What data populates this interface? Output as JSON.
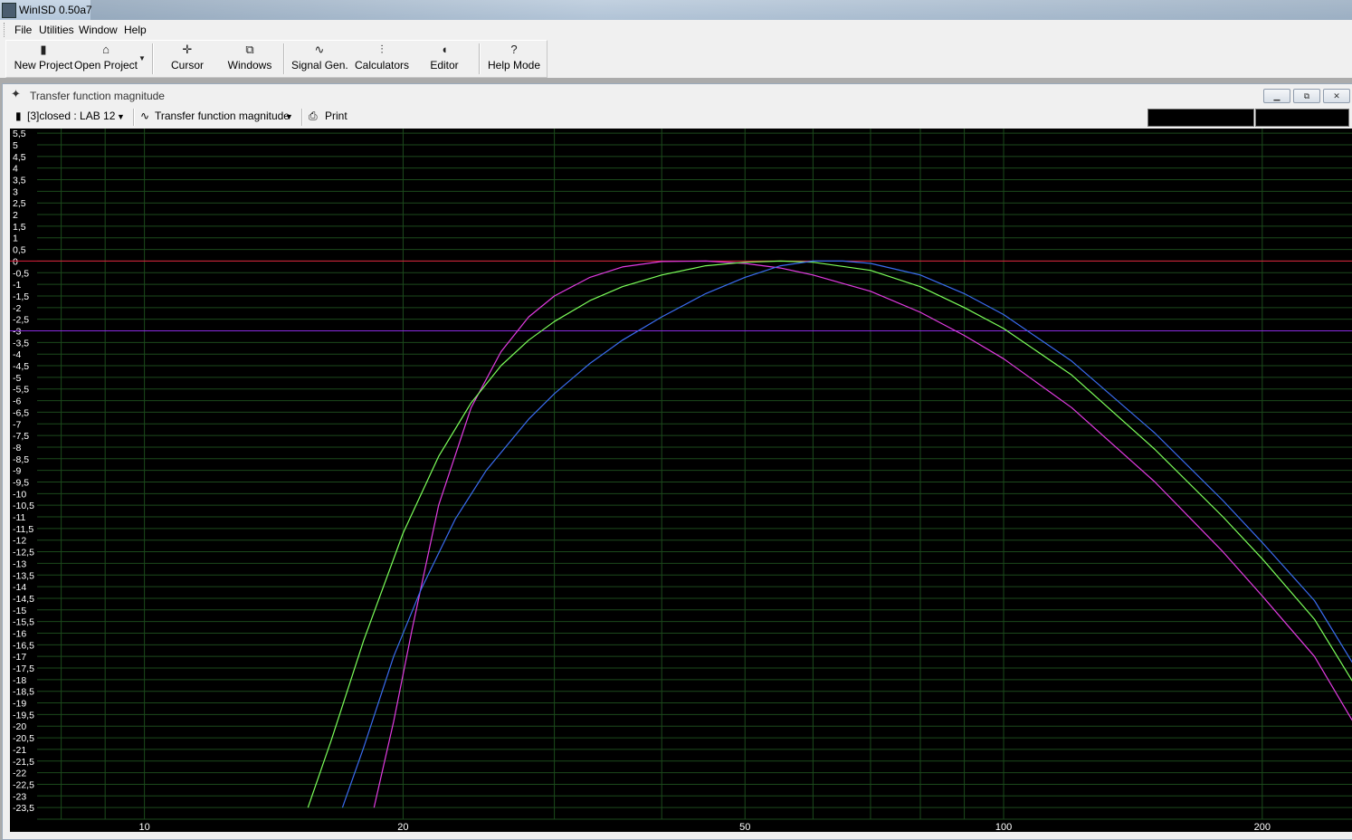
{
  "window": {
    "title": "WinISD 0.50a7"
  },
  "menu": [
    {
      "label": "File"
    },
    {
      "label": "Utilities"
    },
    {
      "label": "Window"
    },
    {
      "label": "Help"
    }
  ],
  "toolbar": {
    "new_project": "New Project",
    "open_project": "Open Project",
    "cursor": "Cursor",
    "windows": "Windows",
    "signal_gen": "Signal Gen.",
    "calculators": "Calculators",
    "editor": "Editor",
    "help_mode": "Help Mode"
  },
  "child_window": {
    "title": "Transfer function magnitude",
    "project_select": "[3]closed : LAB 12",
    "graph_select": "Transfer function magnitude",
    "print": "Print"
  },
  "colors": {
    "background": "#000000",
    "grid": "#1c4a1c",
    "zero_line": "#e0203c",
    "minus3_line": "#8a2be2",
    "series_magenta": "#e23be2",
    "series_green": "#7cff5a",
    "series_blue": "#3a6cf0"
  },
  "chart_data": {
    "type": "line",
    "x_scale": "log",
    "xlim": [
      7.5,
      255
    ],
    "ylim": [
      -24,
      5.7
    ],
    "x_tick_labels": [
      "10",
      "20",
      "50",
      "100",
      "200"
    ],
    "y_tick_labels": [
      "5,5",
      "5",
      "4,5",
      "4",
      "3,5",
      "3",
      "2,5",
      "2",
      "1,5",
      "1",
      "0,5",
      "0",
      "-0,5",
      "-1",
      "-1,5",
      "-2",
      "-2,5",
      "-3",
      "-3,5",
      "-4",
      "-4,5",
      "-5",
      "-5,5",
      "-6",
      "-6,5",
      "-7",
      "-7,5",
      "-8",
      "-8,5",
      "-9",
      "-9,5",
      "-10",
      "-10,5",
      "-11",
      "-11,5",
      "-12",
      "-12,5",
      "-13",
      "-13,5",
      "-14",
      "-14,5",
      "-15",
      "-15,5",
      "-16",
      "-16,5",
      "-17",
      "-17,5",
      "-18",
      "-18,5",
      "-19",
      "-19,5",
      "-20",
      "-20,5",
      "-21",
      "-21,5",
      "-22",
      "-22,5",
      "-23",
      "-23,5"
    ],
    "reference_lines": [
      {
        "y": 0,
        "color": "#e0203c"
      },
      {
        "y": -3,
        "color": "#8a2be2"
      }
    ],
    "series": [
      {
        "color": "#e23be2",
        "x": [
          18.5,
          19.5,
          20.5,
          22,
          24,
          26,
          28,
          30,
          33,
          36,
          40,
          45,
          50,
          55,
          60,
          70,
          80,
          90,
          100,
          120,
          150,
          180,
          200,
          230,
          255
        ],
        "y": [
          -23.5,
          -19.8,
          -15.8,
          -10.5,
          -6.3,
          -3.9,
          -2.4,
          -1.5,
          -0.7,
          -0.25,
          -0.02,
          0,
          -0.1,
          -0.3,
          -0.6,
          -1.3,
          -2.2,
          -3.2,
          -4.2,
          -6.3,
          -9.5,
          -12.5,
          -14.4,
          -17.0,
          -19.8
        ]
      },
      {
        "color": "#7cff5a",
        "x": [
          15.5,
          16.5,
          18,
          20,
          22,
          24,
          26,
          28,
          30,
          33,
          36,
          40,
          45,
          50,
          55,
          60,
          70,
          80,
          90,
          100,
          120,
          150,
          180,
          200,
          230,
          255
        ],
        "y": [
          -23.5,
          -20.6,
          -16.3,
          -11.7,
          -8.4,
          -6.1,
          -4.5,
          -3.4,
          -2.6,
          -1.7,
          -1.1,
          -0.6,
          -0.2,
          -0.05,
          0,
          -0.05,
          -0.4,
          -1.1,
          -2.0,
          -2.9,
          -4.9,
          -8.1,
          -11.0,
          -12.8,
          -15.4,
          -18.1
        ]
      },
      {
        "color": "#3a6cf0",
        "x": [
          17,
          18,
          19.5,
          21,
          23,
          25,
          28,
          30,
          33,
          36,
          40,
          45,
          50,
          55,
          60,
          65,
          70,
          80,
          90,
          100,
          120,
          150,
          180,
          200,
          230,
          255
        ],
        "y": [
          -23.5,
          -20.9,
          -17.0,
          -14.1,
          -11.1,
          -9.0,
          -6.8,
          -5.7,
          -4.4,
          -3.4,
          -2.4,
          -1.4,
          -0.7,
          -0.2,
          0,
          0,
          -0.1,
          -0.6,
          -1.4,
          -2.3,
          -4.3,
          -7.4,
          -10.3,
          -12.1,
          -14.6,
          -17.3
        ]
      }
    ]
  }
}
